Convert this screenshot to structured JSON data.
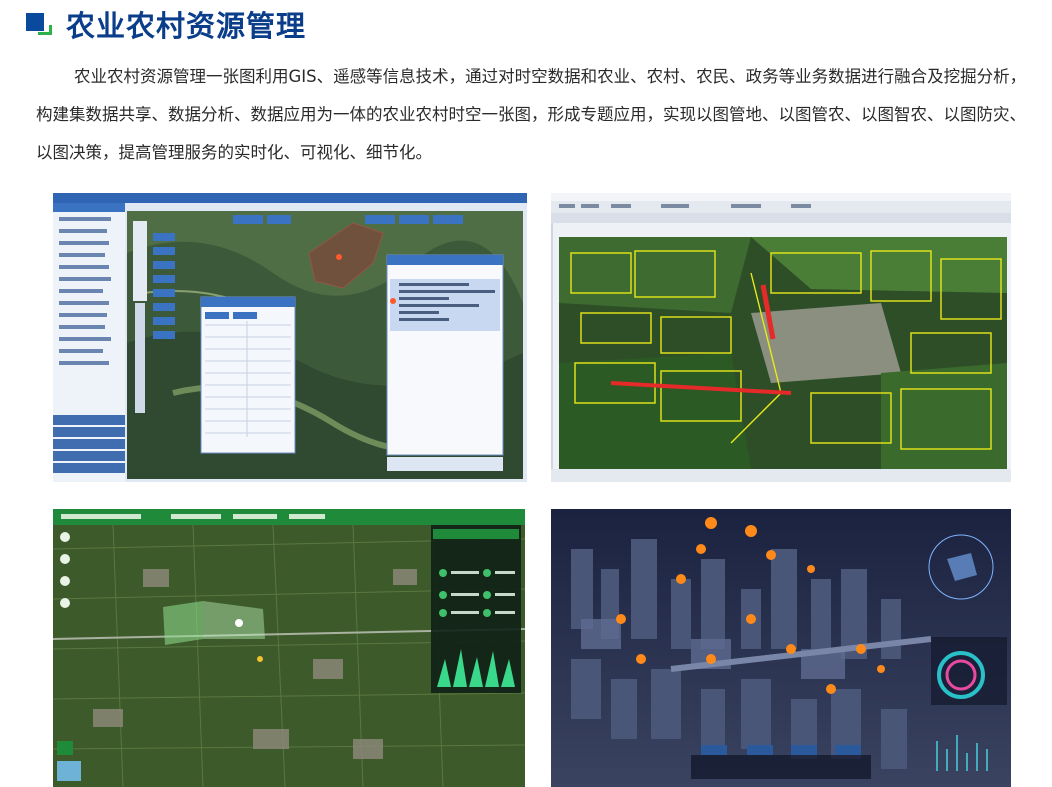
{
  "section": {
    "title": "农业农村资源管理",
    "paragraph": "农业农村资源管理一张图利用GIS、遥感等信息技术，通过对时空数据和农业、农村、农民、政务等业务数据进行融合及挖掘分析，构建集数据共享、数据分析、数据应用为一体的农业农村时空一张图，形成专题应用，实现以图管地、以图管农、以图智农、以图防灾、以图决策，提高管理服务的实时化、可视化、细节化。"
  },
  "screenshots": [
    {
      "id": "gis-mining-map",
      "description_icon": "satellite-map"
    },
    {
      "id": "farmland-parcel-map",
      "description_icon": "parcel-map"
    },
    {
      "id": "agri-platform-dashboard",
      "description_icon": "dashboard-map"
    },
    {
      "id": "3d-city-view",
      "description_icon": "3d-city"
    }
  ],
  "colors": {
    "title": "#0a3d8a",
    "accent_square": "#0a4a9c",
    "accent_green": "#2db24a"
  }
}
